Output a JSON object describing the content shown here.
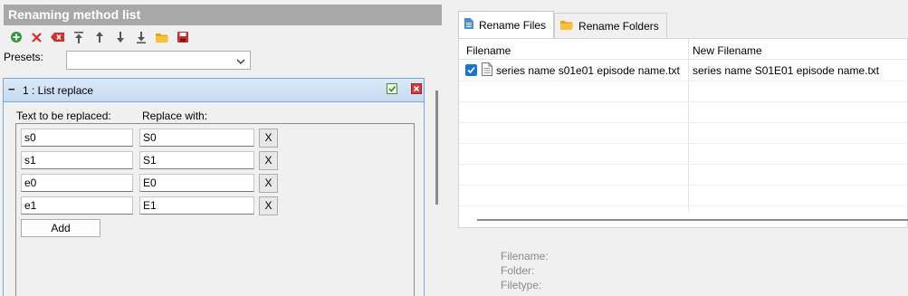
{
  "left": {
    "header_title": "Renaming method list",
    "toolbar_icons": [
      "add-icon",
      "delete-icon",
      "clear-icon",
      "move-top-icon",
      "move-up-icon",
      "move-down-icon",
      "move-bottom-icon",
      "open-folder-icon",
      "save-icon"
    ],
    "presets_label": "Presets:",
    "presets_value": "",
    "method": {
      "collapse_symbol": "−",
      "title": "1 : List replace",
      "col_replace": "Text to be replaced:",
      "col_with": "Replace with:",
      "rows": [
        {
          "from": "s0",
          "to": "S0",
          "x": "X"
        },
        {
          "from": "s1",
          "to": "S1",
          "x": "X"
        },
        {
          "from": "e0",
          "to": "E0",
          "x": "X"
        },
        {
          "from": "e1",
          "to": "E1",
          "x": "X"
        }
      ],
      "add_label": "Add"
    }
  },
  "right": {
    "tabs": [
      {
        "label": "Rename Files",
        "active": true
      },
      {
        "label": "Rename Folders",
        "active": false
      }
    ],
    "columns": [
      "Filename",
      "New Filename"
    ],
    "files": [
      {
        "checked": true,
        "filename": "series name s01e01 episode name.txt",
        "new_filename": "series name S01E01 episode name.txt"
      }
    ],
    "info_labels": [
      "Filename:",
      "Folder:",
      "Filetype:"
    ]
  }
}
